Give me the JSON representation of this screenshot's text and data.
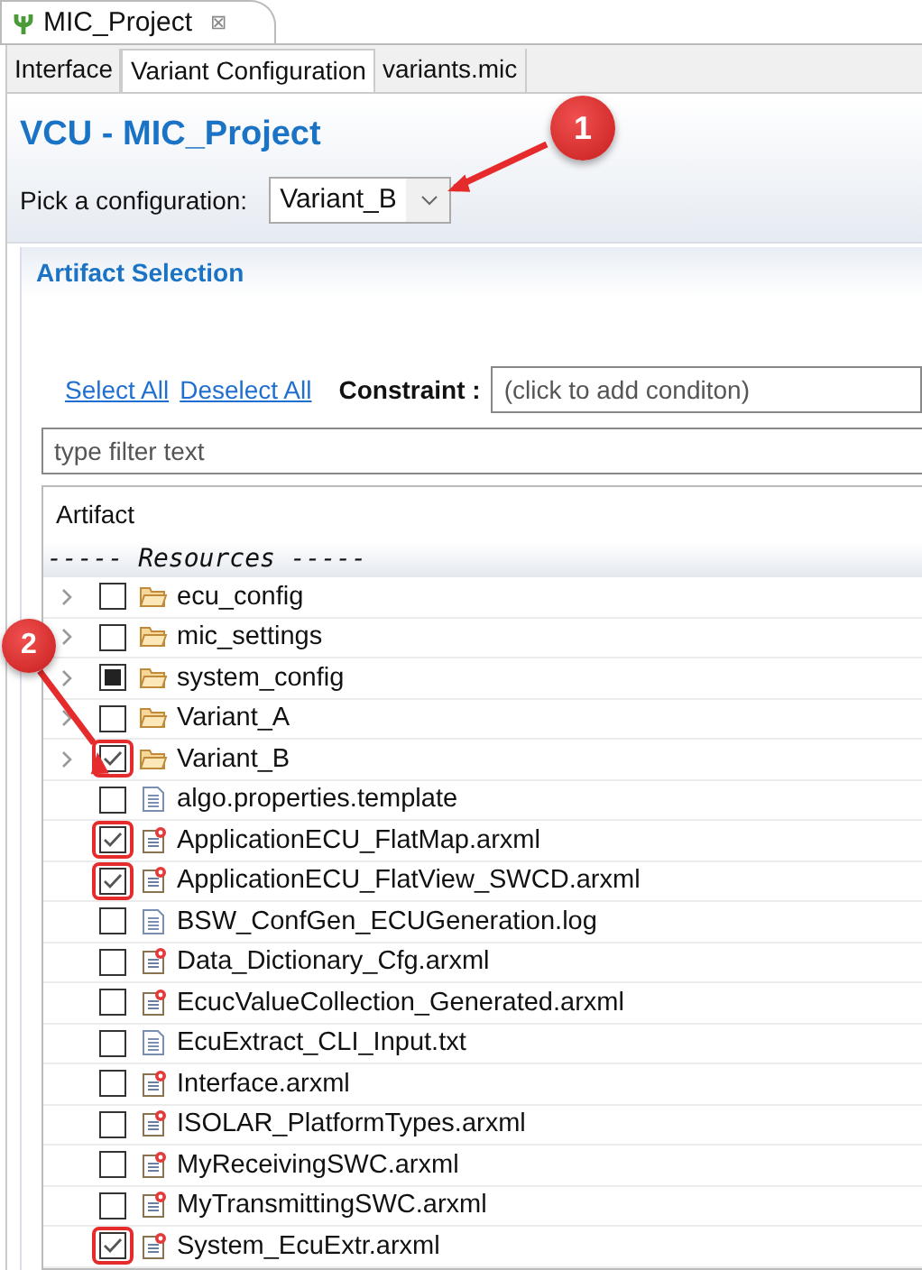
{
  "editor_tab": {
    "title": "MIC_Project",
    "close": "⊠"
  },
  "tabs": [
    {
      "label": "Interface",
      "selected": false
    },
    {
      "label": "Variant Configuration",
      "selected": true
    },
    {
      "label": "variants.mic",
      "selected": false
    }
  ],
  "form_title": "VCU - MIC_Project",
  "configuration": {
    "label": "Pick a configuration:",
    "value": "Variant_B"
  },
  "section": {
    "title": "Artifact Selection",
    "links": [
      "Select All",
      "Deselect All"
    ],
    "constraint": {
      "label": "Constraint :",
      "placeholder": "(click to add conditon)"
    },
    "filter": {
      "placeholder": "type filter text"
    },
    "tree": {
      "column": "Artifact",
      "group": "----- Resources -----",
      "rows": [
        {
          "kind": "folder",
          "name": "ecu_config",
          "checked": false,
          "partial": false,
          "highlighted": false
        },
        {
          "kind": "folder",
          "name": "mic_settings",
          "checked": false,
          "partial": false,
          "highlighted": false
        },
        {
          "kind": "folder",
          "name": "system_config",
          "checked": false,
          "partial": true,
          "highlighted": false
        },
        {
          "kind": "folder",
          "name": "Variant_A",
          "checked": false,
          "partial": false,
          "highlighted": false
        },
        {
          "kind": "folder",
          "name": "Variant_B",
          "checked": true,
          "partial": false,
          "highlighted": true
        },
        {
          "kind": "file",
          "name": "algo.properties.template",
          "checked": false,
          "partial": false,
          "highlighted": false
        },
        {
          "kind": "model",
          "name": "ApplicationECU_FlatMap.arxml",
          "checked": true,
          "partial": false,
          "highlighted": true
        },
        {
          "kind": "model",
          "name": "ApplicationECU_FlatView_SWCD.arxml",
          "checked": true,
          "partial": false,
          "highlighted": true
        },
        {
          "kind": "file",
          "name": "BSW_ConfGen_ECUGeneration.log",
          "checked": false,
          "partial": false,
          "highlighted": false
        },
        {
          "kind": "model",
          "name": "Data_Dictionary_Cfg.arxml",
          "checked": false,
          "partial": false,
          "highlighted": false
        },
        {
          "kind": "model",
          "name": "EcucValueCollection_Generated.arxml",
          "checked": false,
          "partial": false,
          "highlighted": false
        },
        {
          "kind": "file",
          "name": "EcuExtract_CLI_Input.txt",
          "checked": false,
          "partial": false,
          "highlighted": false
        },
        {
          "kind": "model",
          "name": "Interface.arxml",
          "checked": false,
          "partial": false,
          "highlighted": false
        },
        {
          "kind": "model",
          "name": "ISOLAR_PlatformTypes.arxml",
          "checked": false,
          "partial": false,
          "highlighted": false
        },
        {
          "kind": "model",
          "name": "MyReceivingSWC.arxml",
          "checked": false,
          "partial": false,
          "highlighted": false
        },
        {
          "kind": "model",
          "name": "MyTransmittingSWC.arxml",
          "checked": false,
          "partial": false,
          "highlighted": false
        },
        {
          "kind": "model",
          "name": "System_EcuExtr.arxml",
          "checked": true,
          "partial": false,
          "highlighted": true
        }
      ]
    }
  },
  "callouts": [
    {
      "number": "1"
    },
    {
      "number": "2"
    }
  ]
}
